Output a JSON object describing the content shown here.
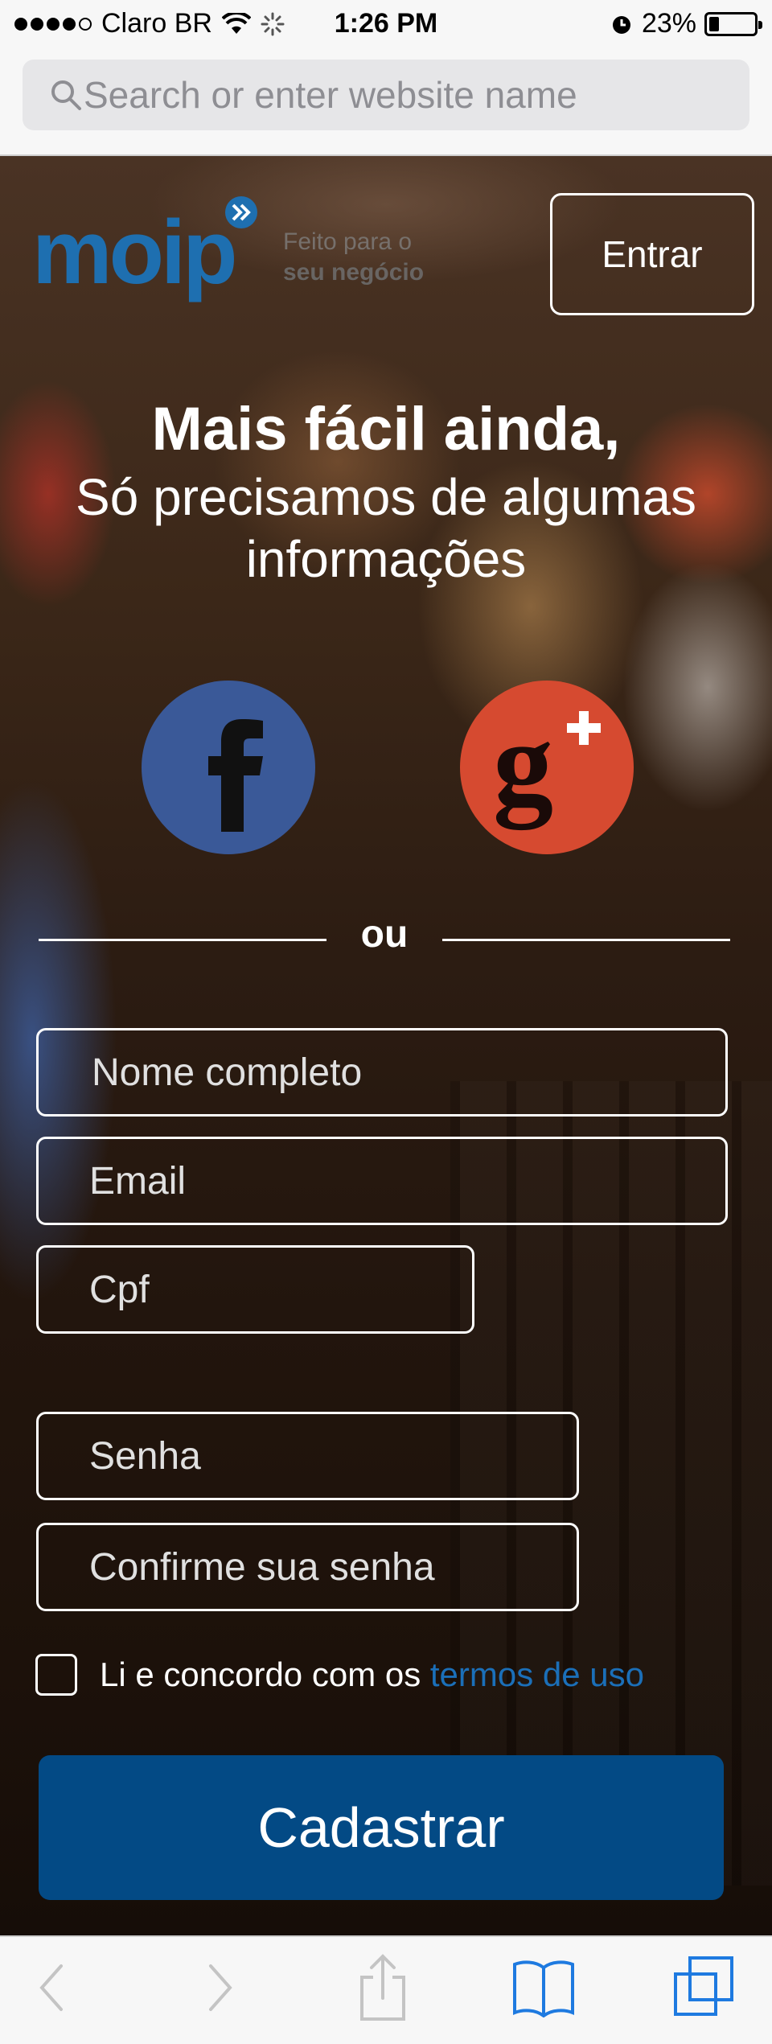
{
  "status_bar": {
    "carrier": "Claro BR",
    "time": "1:26 PM",
    "battery_percent": "23%",
    "battery_level": 0.23
  },
  "browser": {
    "search_placeholder": "Search or enter website name"
  },
  "header": {
    "logo_text": "moip",
    "tagline_line1": "Feito para o",
    "tagline_line2": "seu negócio",
    "login_button": "Entrar"
  },
  "intro": {
    "headline": "Mais fácil ainda,",
    "subheadline": "Só precisamos de algumas informações"
  },
  "social": {
    "facebook_icon": "facebook-icon",
    "google_icon": "google-plus-icon",
    "separator": "ou"
  },
  "form": {
    "name_placeholder": "Nome completo",
    "email_placeholder": "Email",
    "cpf_placeholder": "Cpf",
    "password_placeholder": "Senha",
    "confirm_placeholder": "Confirme sua senha",
    "terms_text": "Li e concordo com os ",
    "terms_link": "termos de uso",
    "submit_label": "Cadastrar"
  },
  "colors": {
    "brand_blue": "#1e6fb0",
    "submit_blue": "#034a85",
    "facebook": "#3a5998",
    "google": "#d64a30",
    "link": "#1b6fb8"
  }
}
